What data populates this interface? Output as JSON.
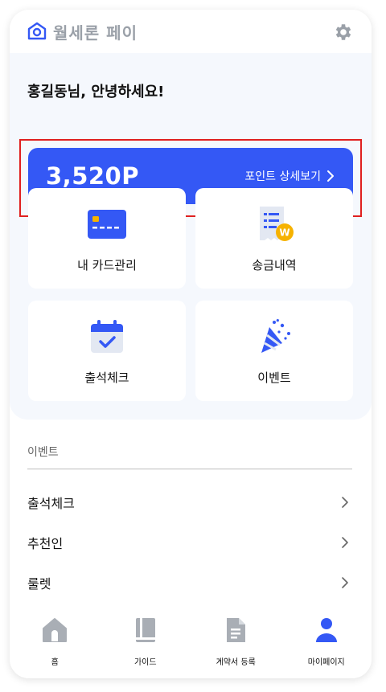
{
  "header": {
    "app_title": "월세론 페이"
  },
  "greeting": "홍길동님, 안녕하세요!",
  "point_card": {
    "points": "3,520P",
    "detail_label": "포인트 상세보기"
  },
  "tiles": [
    {
      "label": "내 카드관리",
      "icon": "credit-card-icon"
    },
    {
      "label": "송금내역",
      "icon": "receipt-won-icon"
    },
    {
      "label": "출석체크",
      "icon": "calendar-check-icon"
    },
    {
      "label": "이벤트",
      "icon": "party-popper-icon"
    }
  ],
  "events_section": {
    "title": "이벤트",
    "items": [
      {
        "label": "출석체크"
      },
      {
        "label": "추천인"
      },
      {
        "label": "룰렛"
      }
    ]
  },
  "bottom_nav": [
    {
      "label": "홈",
      "icon": "home-icon"
    },
    {
      "label": "가이드",
      "icon": "book-icon"
    },
    {
      "label": "계약서 등록",
      "icon": "document-icon"
    },
    {
      "label": "마이페이지",
      "icon": "person-icon",
      "active": true
    }
  ],
  "colors": {
    "accent": "#3458f5",
    "highlight": "#e02020",
    "panel_bg": "#f5f8fd",
    "nav_inactive": "#a9aeb5",
    "gold": "#f6b200"
  }
}
